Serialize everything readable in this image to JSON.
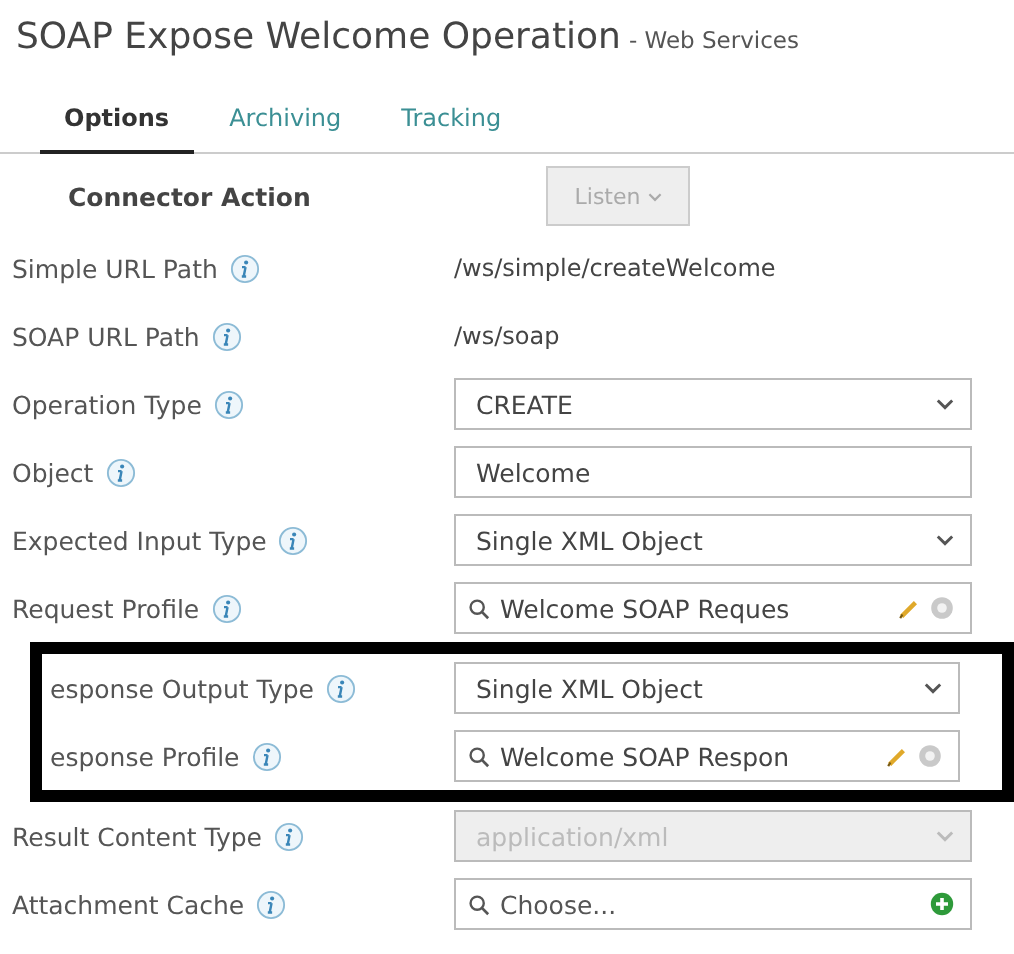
{
  "title": {
    "main": "SOAP Expose Welcome Operation",
    "suffix": "- Web Services"
  },
  "tabs": [
    {
      "label": "Options",
      "selected": true
    },
    {
      "label": "Archiving",
      "selected": false
    },
    {
      "label": "Tracking",
      "selected": false
    }
  ],
  "rows": [
    {
      "kind": "action",
      "label": "Connector Action",
      "value": "Listen",
      "disabled": true,
      "highlighted": false
    },
    {
      "kind": "text",
      "label": "Simple URL Path",
      "value": "/ws/simple/createWelcome",
      "highlighted": false
    },
    {
      "kind": "text",
      "label": "SOAP URL Path",
      "value": "/ws/soap",
      "highlighted": false
    },
    {
      "kind": "select",
      "label": "Operation Type",
      "value": "CREATE",
      "disabled": false,
      "highlighted": false
    },
    {
      "kind": "input",
      "label": "Object",
      "value": "Welcome",
      "highlighted": false
    },
    {
      "kind": "select",
      "label": "Expected Input Type",
      "value": "Single XML Object",
      "disabled": false,
      "highlighted": false
    },
    {
      "kind": "profile",
      "label": "Request Profile",
      "value": "Welcome SOAP Reques",
      "highlighted": false
    },
    {
      "kind": "select",
      "label": "esponse Output Type",
      "value": "Single XML Object",
      "disabled": false,
      "highlighted": true
    },
    {
      "kind": "profile",
      "label": "esponse Profile",
      "value": "Welcome SOAP Respon",
      "highlighted": true
    },
    {
      "kind": "select",
      "label": "Result Content Type",
      "value": "application/xml",
      "disabled": true,
      "highlighted": false
    },
    {
      "kind": "choose",
      "label": "Attachment Cache",
      "placeholder": "Choose...",
      "highlighted": false
    }
  ]
}
